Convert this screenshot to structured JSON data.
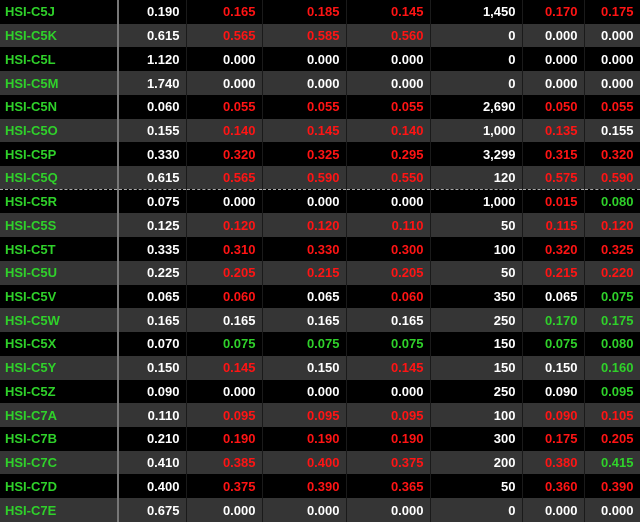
{
  "colors": {
    "up": "#2fd12a",
    "down": "#ff1414",
    "neutral": "#ffffff",
    "row_dark": "#000000",
    "row_alt": "#353535"
  },
  "rows": [
    {
      "code": "HSI-C5J",
      "cells": [
        {
          "v": "0.190",
          "c": "w"
        },
        {
          "v": "0.165",
          "c": "r"
        },
        {
          "v": "0.185",
          "c": "r"
        },
        {
          "v": "0.145",
          "c": "r"
        },
        {
          "v": "1,450",
          "c": "w"
        },
        {
          "v": "0.170",
          "c": "r"
        },
        {
          "v": "0.175",
          "c": "r"
        }
      ]
    },
    {
      "code": "HSI-C5K",
      "cells": [
        {
          "v": "0.615",
          "c": "w"
        },
        {
          "v": "0.565",
          "c": "r"
        },
        {
          "v": "0.585",
          "c": "r"
        },
        {
          "v": "0.560",
          "c": "r"
        },
        {
          "v": "0",
          "c": "w"
        },
        {
          "v": "0.000",
          "c": "w"
        },
        {
          "v": "0.000",
          "c": "w"
        }
      ]
    },
    {
      "code": "HSI-C5L",
      "cells": [
        {
          "v": "1.120",
          "c": "w"
        },
        {
          "v": "0.000",
          "c": "w"
        },
        {
          "v": "0.000",
          "c": "w"
        },
        {
          "v": "0.000",
          "c": "w"
        },
        {
          "v": "0",
          "c": "w"
        },
        {
          "v": "0.000",
          "c": "w"
        },
        {
          "v": "0.000",
          "c": "w"
        }
      ]
    },
    {
      "code": "HSI-C5M",
      "cells": [
        {
          "v": "1.740",
          "c": "w"
        },
        {
          "v": "0.000",
          "c": "w"
        },
        {
          "v": "0.000",
          "c": "w"
        },
        {
          "v": "0.000",
          "c": "w"
        },
        {
          "v": "0",
          "c": "w"
        },
        {
          "v": "0.000",
          "c": "w"
        },
        {
          "v": "0.000",
          "c": "w"
        }
      ]
    },
    {
      "code": "HSI-C5N",
      "cells": [
        {
          "v": "0.060",
          "c": "w"
        },
        {
          "v": "0.055",
          "c": "r"
        },
        {
          "v": "0.055",
          "c": "r"
        },
        {
          "v": "0.055",
          "c": "r"
        },
        {
          "v": "2,690",
          "c": "w"
        },
        {
          "v": "0.050",
          "c": "r"
        },
        {
          "v": "0.055",
          "c": "r"
        }
      ]
    },
    {
      "code": "HSI-C5O",
      "cells": [
        {
          "v": "0.155",
          "c": "w"
        },
        {
          "v": "0.140",
          "c": "r"
        },
        {
          "v": "0.145",
          "c": "r"
        },
        {
          "v": "0.140",
          "c": "r"
        },
        {
          "v": "1,000",
          "c": "w"
        },
        {
          "v": "0.135",
          "c": "r"
        },
        {
          "v": "0.155",
          "c": "w"
        }
      ]
    },
    {
      "code": "HSI-C5P",
      "cells": [
        {
          "v": "0.330",
          "c": "w"
        },
        {
          "v": "0.320",
          "c": "r"
        },
        {
          "v": "0.325",
          "c": "r"
        },
        {
          "v": "0.295",
          "c": "r"
        },
        {
          "v": "3,299",
          "c": "w"
        },
        {
          "v": "0.315",
          "c": "r"
        },
        {
          "v": "0.320",
          "c": "r"
        }
      ]
    },
    {
      "code": "HSI-C5Q",
      "cells": [
        {
          "v": "0.615",
          "c": "w"
        },
        {
          "v": "0.565",
          "c": "r"
        },
        {
          "v": "0.590",
          "c": "r"
        },
        {
          "v": "0.550",
          "c": "r"
        },
        {
          "v": "120",
          "c": "w"
        },
        {
          "v": "0.575",
          "c": "r"
        },
        {
          "v": "0.590",
          "c": "r"
        }
      ]
    },
    {
      "code": "HSI-C5R",
      "cells": [
        {
          "v": "0.075",
          "c": "w"
        },
        {
          "v": "0.000",
          "c": "w"
        },
        {
          "v": "0.000",
          "c": "w"
        },
        {
          "v": "0.000",
          "c": "w"
        },
        {
          "v": "1,000",
          "c": "w"
        },
        {
          "v": "0.015",
          "c": "r"
        },
        {
          "v": "0.080",
          "c": "g"
        }
      ]
    },
    {
      "code": "HSI-C5S",
      "cells": [
        {
          "v": "0.125",
          "c": "w"
        },
        {
          "v": "0.120",
          "c": "r"
        },
        {
          "v": "0.120",
          "c": "r"
        },
        {
          "v": "0.110",
          "c": "r"
        },
        {
          "v": "50",
          "c": "w"
        },
        {
          "v": "0.115",
          "c": "r"
        },
        {
          "v": "0.120",
          "c": "r"
        }
      ]
    },
    {
      "code": "HSI-C5T",
      "cells": [
        {
          "v": "0.335",
          "c": "w"
        },
        {
          "v": "0.310",
          "c": "r"
        },
        {
          "v": "0.330",
          "c": "r"
        },
        {
          "v": "0.300",
          "c": "r"
        },
        {
          "v": "100",
          "c": "w"
        },
        {
          "v": "0.320",
          "c": "r"
        },
        {
          "v": "0.325",
          "c": "r"
        }
      ]
    },
    {
      "code": "HSI-C5U",
      "cells": [
        {
          "v": "0.225",
          "c": "w"
        },
        {
          "v": "0.205",
          "c": "r"
        },
        {
          "v": "0.215",
          "c": "r"
        },
        {
          "v": "0.205",
          "c": "r"
        },
        {
          "v": "50",
          "c": "w"
        },
        {
          "v": "0.215",
          "c": "r"
        },
        {
          "v": "0.220",
          "c": "r"
        }
      ]
    },
    {
      "code": "HSI-C5V",
      "cells": [
        {
          "v": "0.065",
          "c": "w"
        },
        {
          "v": "0.060",
          "c": "r"
        },
        {
          "v": "0.065",
          "c": "w"
        },
        {
          "v": "0.060",
          "c": "r"
        },
        {
          "v": "350",
          "c": "w"
        },
        {
          "v": "0.065",
          "c": "w"
        },
        {
          "v": "0.075",
          "c": "g"
        }
      ]
    },
    {
      "code": "HSI-C5W",
      "cells": [
        {
          "v": "0.165",
          "c": "w"
        },
        {
          "v": "0.165",
          "c": "w"
        },
        {
          "v": "0.165",
          "c": "w"
        },
        {
          "v": "0.165",
          "c": "w"
        },
        {
          "v": "250",
          "c": "w"
        },
        {
          "v": "0.170",
          "c": "g"
        },
        {
          "v": "0.175",
          "c": "g"
        }
      ]
    },
    {
      "code": "HSI-C5X",
      "cells": [
        {
          "v": "0.070",
          "c": "w"
        },
        {
          "v": "0.075",
          "c": "g"
        },
        {
          "v": "0.075",
          "c": "g"
        },
        {
          "v": "0.075",
          "c": "g"
        },
        {
          "v": "150",
          "c": "w"
        },
        {
          "v": "0.075",
          "c": "g"
        },
        {
          "v": "0.080",
          "c": "g"
        }
      ]
    },
    {
      "code": "HSI-C5Y",
      "cells": [
        {
          "v": "0.150",
          "c": "w"
        },
        {
          "v": "0.145",
          "c": "r"
        },
        {
          "v": "0.150",
          "c": "w"
        },
        {
          "v": "0.145",
          "c": "r"
        },
        {
          "v": "150",
          "c": "w"
        },
        {
          "v": "0.150",
          "c": "w"
        },
        {
          "v": "0.160",
          "c": "g"
        }
      ]
    },
    {
      "code": "HSI-C5Z",
      "cells": [
        {
          "v": "0.090",
          "c": "w"
        },
        {
          "v": "0.000",
          "c": "w"
        },
        {
          "v": "0.000",
          "c": "w"
        },
        {
          "v": "0.000",
          "c": "w"
        },
        {
          "v": "250",
          "c": "w"
        },
        {
          "v": "0.090",
          "c": "w"
        },
        {
          "v": "0.095",
          "c": "g"
        }
      ]
    },
    {
      "code": "HSI-C7A",
      "cells": [
        {
          "v": "0.110",
          "c": "w"
        },
        {
          "v": "0.095",
          "c": "r"
        },
        {
          "v": "0.095",
          "c": "r"
        },
        {
          "v": "0.095",
          "c": "r"
        },
        {
          "v": "100",
          "c": "w"
        },
        {
          "v": "0.090",
          "c": "r"
        },
        {
          "v": "0.105",
          "c": "r"
        }
      ]
    },
    {
      "code": "HSI-C7B",
      "cells": [
        {
          "v": "0.210",
          "c": "w"
        },
        {
          "v": "0.190",
          "c": "r"
        },
        {
          "v": "0.190",
          "c": "r"
        },
        {
          "v": "0.190",
          "c": "r"
        },
        {
          "v": "300",
          "c": "w"
        },
        {
          "v": "0.175",
          "c": "r"
        },
        {
          "v": "0.205",
          "c": "r"
        }
      ]
    },
    {
      "code": "HSI-C7C",
      "cells": [
        {
          "v": "0.410",
          "c": "w"
        },
        {
          "v": "0.385",
          "c": "r"
        },
        {
          "v": "0.400",
          "c": "r"
        },
        {
          "v": "0.375",
          "c": "r"
        },
        {
          "v": "200",
          "c": "w"
        },
        {
          "v": "0.380",
          "c": "r"
        },
        {
          "v": "0.415",
          "c": "g"
        }
      ]
    },
    {
      "code": "HSI-C7D",
      "cells": [
        {
          "v": "0.400",
          "c": "w"
        },
        {
          "v": "0.375",
          "c": "r"
        },
        {
          "v": "0.390",
          "c": "r"
        },
        {
          "v": "0.365",
          "c": "r"
        },
        {
          "v": "50",
          "c": "w"
        },
        {
          "v": "0.360",
          "c": "r"
        },
        {
          "v": "0.390",
          "c": "r"
        }
      ]
    },
    {
      "code": "HSI-C7E",
      "cells": [
        {
          "v": "0.675",
          "c": "w"
        },
        {
          "v": "0.000",
          "c": "w"
        },
        {
          "v": "0.000",
          "c": "w"
        },
        {
          "v": "0.000",
          "c": "w"
        },
        {
          "v": "0",
          "c": "w"
        },
        {
          "v": "0.000",
          "c": "w"
        },
        {
          "v": "0.000",
          "c": "w"
        }
      ]
    }
  ]
}
